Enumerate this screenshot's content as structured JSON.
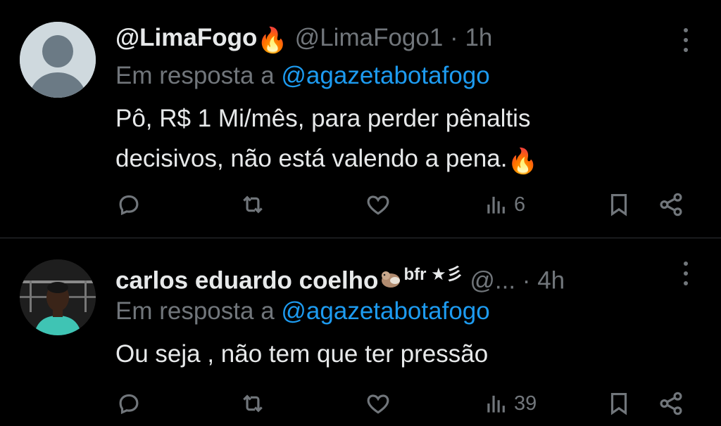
{
  "tweets": [
    {
      "display_name": "@LimaFogo",
      "name_emoji": "🔥",
      "handle": "@LimaFogo1",
      "separator": "·",
      "time": "1h",
      "reply_prefix": "Em resposta a",
      "reply_to": "@agazetabotafogo",
      "text_lines": [
        "Pô, R$ 1 Mi/mês, para perder pênaltis",
        "decisivos, não está valendo a pena."
      ],
      "text_emoji": "🔥",
      "views": "6"
    },
    {
      "display_name": "carlos eduardo coelho",
      "name_suffix": "bfr ★彡",
      "handle": "@...",
      "separator": "·",
      "time": "4h",
      "reply_prefix": "Em resposta a",
      "reply_to": "@agazetabotafogo",
      "text_lines": [
        "Ou seja , não tem que ter pressão"
      ],
      "views": "39"
    }
  ],
  "colors": {
    "background": "#000000",
    "primary_text": "#e7e9ea",
    "secondary_text": "#71767b",
    "link": "#1d9bf0",
    "divider": "#2f3336"
  },
  "icons": [
    "more-icon",
    "reply-icon",
    "retweet-icon",
    "like-icon",
    "views-icon",
    "bookmark-icon",
    "share-icon",
    "fire-emoji",
    "otter-emoji"
  ]
}
